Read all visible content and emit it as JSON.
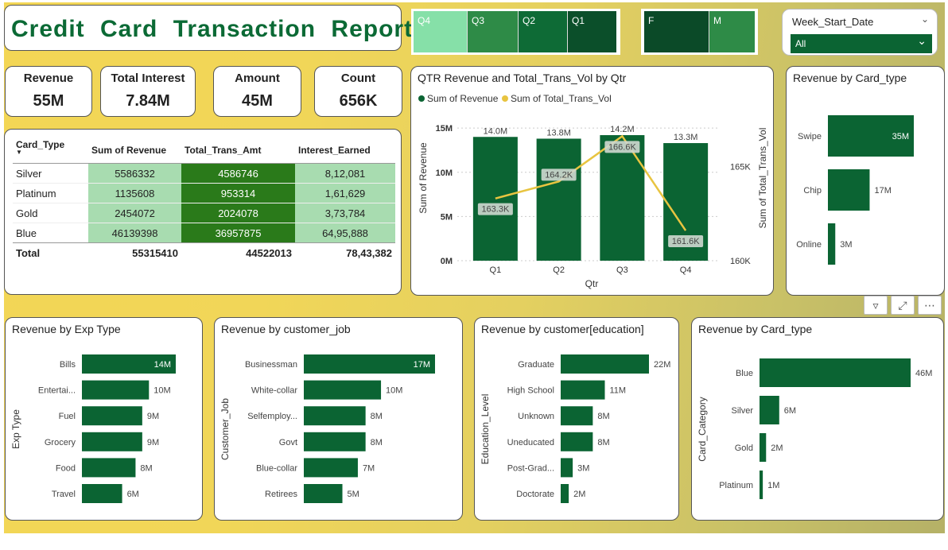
{
  "title": "Credit Card Transaction Report",
  "quarter_slicer": [
    "Q4",
    "Q3",
    "Q2",
    "Q1"
  ],
  "gender_slicer": [
    "F",
    "M"
  ],
  "week_slicer": {
    "label": "Week_Start_Date",
    "value": "All"
  },
  "kpis": [
    {
      "label": "Revenue",
      "value": "55M"
    },
    {
      "label": "Total Interest",
      "value": "7.84M"
    },
    {
      "label": "Amount",
      "value": "45M"
    },
    {
      "label": "Count",
      "value": "656K"
    }
  ],
  "matrix": {
    "headers": [
      "Card_Type",
      "Sum of Revenue",
      "Total_Trans_Amt",
      "Interest_Earned"
    ],
    "rows": [
      [
        "Silver",
        "5586332",
        "4586746",
        "8,12,081"
      ],
      [
        "Platinum",
        "1135608",
        "953314",
        "1,61,629"
      ],
      [
        "Gold",
        "2454072",
        "2024078",
        "3,73,784"
      ],
      [
        "Blue",
        "46139398",
        "36957875",
        "64,95,888"
      ]
    ],
    "total": [
      "Total",
      "55315410",
      "44522013",
      "78,43,382"
    ]
  },
  "colors": {
    "dark_green": "#0b6433",
    "mid_green": "#2e8b47",
    "light_green": "#a8dcb0",
    "gold": "#e8c440"
  },
  "charts": {
    "qtr": {
      "title": "QTR Revenue and Total_Trans_Vol by Qtr",
      "xlabel": "Qtr",
      "ylabel": "Sum of Revenue",
      "y2label": "Sum of Total_Trans_Vol"
    },
    "card_type_top": {
      "title": "Revenue by Card_type"
    },
    "exp_type": {
      "title": "Revenue by Exp Type",
      "ylabel": "Exp Type"
    },
    "customer_job": {
      "title": "Revenue by customer_job",
      "ylabel": "Customer_Job"
    },
    "education": {
      "title": "Revenue by customer[education]",
      "ylabel": "Education_Level"
    },
    "card_category": {
      "title": "Revenue by Card_type",
      "ylabel": "Card_Category"
    }
  },
  "chart_data": [
    {
      "type": "bar",
      "title": "QTR Revenue and Total_Trans_Vol by Qtr",
      "categories": [
        "Q1",
        "Q2",
        "Q3",
        "Q4"
      ],
      "series": [
        {
          "name": "Sum of Revenue",
          "values": [
            14.0,
            13.8,
            14.2,
            13.3
          ],
          "labels": [
            "14.0M",
            "13.8M",
            "14.2M",
            "13.3M"
          ],
          "color": "#0b6433"
        },
        {
          "name": "Sum of Total_Trans_Vol",
          "type": "line",
          "values": [
            163.3,
            164.2,
            166.6,
            161.6
          ],
          "labels": [
            "163.3K",
            "164.2K",
            "166.6K",
            "161.6K"
          ],
          "color": "#e8c440"
        }
      ],
      "yticks": [
        "0M",
        "5M",
        "10M",
        "15M"
      ],
      "y2ticks": [
        "160K",
        "165K"
      ],
      "ylim": [
        0,
        16
      ],
      "y2lim": [
        160,
        167.5
      ],
      "xlabel": "Qtr",
      "ylabel": "Sum of Revenue",
      "y2label": "Sum of Total_Trans_Vol",
      "legend": "top-left"
    },
    {
      "type": "bar",
      "title": "Revenue by Card_type",
      "orientation": "horizontal",
      "categories": [
        "Swipe",
        "Chip",
        "Online"
      ],
      "values": [
        35,
        17,
        3
      ],
      "labels": [
        "35M",
        "17M",
        "3M"
      ]
    },
    {
      "type": "bar",
      "title": "Revenue by Exp Type",
      "orientation": "horizontal",
      "categories": [
        "Bills",
        "Entertai...",
        "Fuel",
        "Grocery",
        "Food",
        "Travel"
      ],
      "values": [
        14,
        10,
        9,
        9,
        8,
        6
      ],
      "labels": [
        "14M",
        "10M",
        "9M",
        "9M",
        "8M",
        "6M"
      ],
      "ylabel": "Exp Type"
    },
    {
      "type": "bar",
      "title": "Revenue by customer_job",
      "orientation": "horizontal",
      "categories": [
        "Businessman",
        "White-collar",
        "Selfemploy...",
        "Govt",
        "Blue-collar",
        "Retirees"
      ],
      "values": [
        17,
        10,
        8,
        8,
        7,
        5
      ],
      "labels": [
        "17M",
        "10M",
        "8M",
        "8M",
        "7M",
        "5M"
      ],
      "ylabel": "Customer_Job"
    },
    {
      "type": "bar",
      "title": "Revenue by customer[education]",
      "orientation": "horizontal",
      "categories": [
        "Graduate",
        "High School",
        "Unknown",
        "Uneducated",
        "Post-Grad...",
        "Doctorate"
      ],
      "values": [
        22,
        11,
        8,
        8,
        3,
        2
      ],
      "labels": [
        "22M",
        "11M",
        "8M",
        "8M",
        "3M",
        "2M"
      ],
      "ylabel": "Education_Level"
    },
    {
      "type": "bar",
      "title": "Revenue by Card_type",
      "orientation": "horizontal",
      "categories": [
        "Blue",
        "Silver",
        "Gold",
        "Platinum"
      ],
      "values": [
        46,
        6,
        2,
        1
      ],
      "labels": [
        "46M",
        "6M",
        "2M",
        "1M"
      ],
      "ylabel": "Card_Category"
    }
  ]
}
